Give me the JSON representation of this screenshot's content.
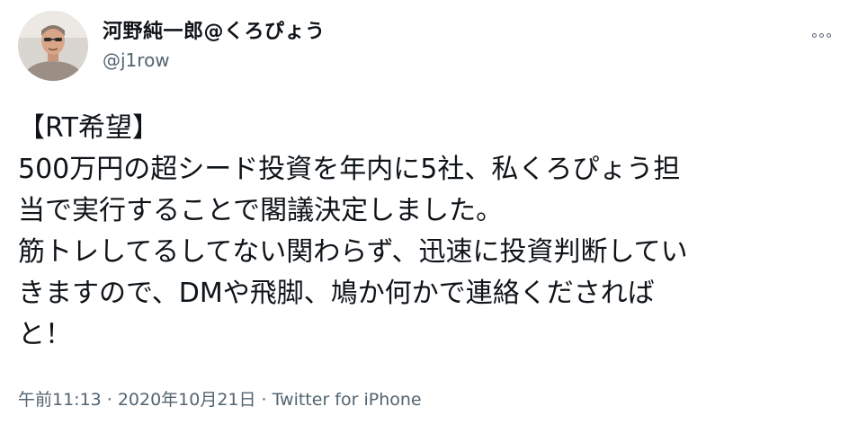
{
  "user": {
    "display_name": "河野純一郎@くろぴょう",
    "handle": "@j1row"
  },
  "icons": {
    "more": "more-icon",
    "avatar": "profile-photo"
  },
  "tweet": {
    "lines": [
      "【RT希望】",
      "500万円の超シード投資を年内に5社、私くろぴょう担",
      "当で実行することで閣議決定しました。",
      "筋トレしてるしてない関わらず、迅速に投資判断してい",
      "きますので、DMや飛脚、鳩か何かで連絡くだされば",
      "と！"
    ]
  },
  "meta": {
    "time": "午前11:13",
    "separator": "·",
    "date": "2020年10月21日",
    "source": "Twitter for iPhone"
  },
  "colors": {
    "text": "#0f1419",
    "secondary": "#536471",
    "background": "#ffffff"
  }
}
